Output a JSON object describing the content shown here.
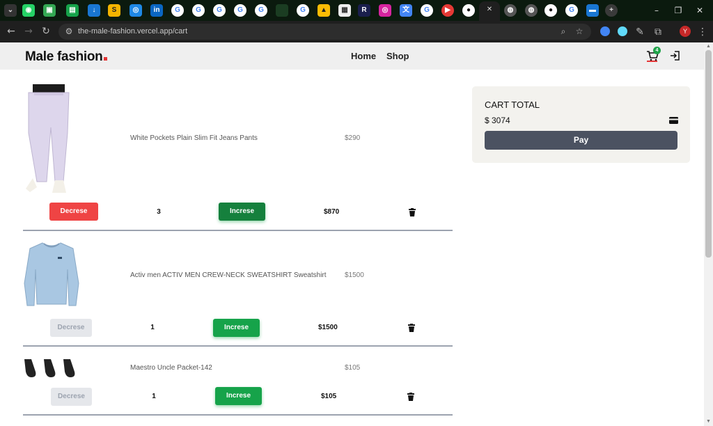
{
  "browser": {
    "url": "the-male-fashion.vercel.app/cart",
    "profile_initial": "Y",
    "tab_close": "✕",
    "new_tab": "+"
  },
  "site": {
    "logo_text": "Male fashion",
    "nav": [
      {
        "label": "Home"
      },
      {
        "label": "Shop"
      }
    ],
    "cart_count": "4"
  },
  "cart": {
    "items": [
      {
        "name": "White Pockets Plain Slim Fit Jeans Pants",
        "unit_price": "$290",
        "quantity": "3",
        "subtotal": "$870",
        "decrease_label": "Decrese",
        "decrease_enabled": true,
        "increase_label": "Increse"
      },
      {
        "name": "Activ men ACTIV MEN CREW-NECK SWEATSHIRT Sweatshirt",
        "unit_price": "$1500",
        "quantity": "1",
        "subtotal": "$1500",
        "decrease_label": "Decrese",
        "decrease_enabled": false,
        "increase_label": "Increse"
      },
      {
        "name": "Maestro Uncle Packet-142",
        "unit_price": "$105",
        "quantity": "1",
        "subtotal": "$105",
        "decrease_label": "Decrese",
        "decrease_enabled": false,
        "increase_label": "Increse"
      }
    ],
    "total_title": "CART TOTAL",
    "total_amount": "$ 3074",
    "pay_label": "Pay"
  },
  "colors": {
    "accent_red": "#e53637",
    "decrease_red": "#ef4444",
    "increase_green": "#16a34a",
    "pay_button": "#4b5261"
  }
}
